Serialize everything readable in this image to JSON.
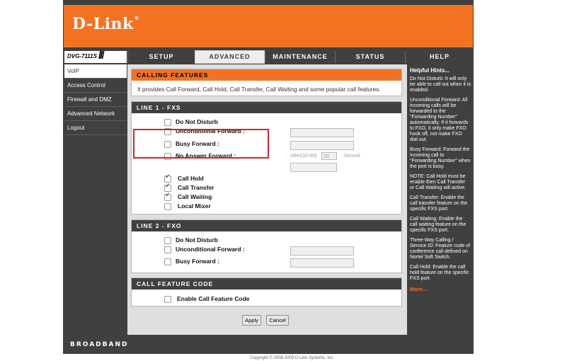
{
  "brand": {
    "logo": "D-Link",
    "footer_brand": "BROADBAND"
  },
  "model": {
    "label": "DVG-7111S"
  },
  "nav": {
    "tabs": [
      {
        "label": "SETUP"
      },
      {
        "label": "ADVANCED"
      },
      {
        "label": "MAINTENANCE"
      },
      {
        "label": "STATUS"
      },
      {
        "label": "HELP"
      }
    ],
    "active_tab": "ADVANCED"
  },
  "sidebar": {
    "items": [
      {
        "label": "VoIP"
      },
      {
        "label": "Access Control"
      },
      {
        "label": "Firewall and DMZ"
      },
      {
        "label": "Advanced Network"
      },
      {
        "label": "Logout"
      }
    ]
  },
  "calling_features": {
    "title": "CALLING FEATURES",
    "description": "It provides Call Forward, Call Hold, Call Transfer, Call Waiting and some popular call features."
  },
  "line1": {
    "title": "LINE 1 - FXS",
    "options": [
      {
        "label": "Do Not Disturb",
        "checked": false
      },
      {
        "label": "Unconditional Forward :",
        "checked": false,
        "value": ""
      },
      {
        "label": "Busy Forward :",
        "checked": false,
        "value": ""
      },
      {
        "label": "No Answer Forward :",
        "checked": false,
        "value": ""
      },
      {
        "label": "Call Hold",
        "checked": true
      },
      {
        "label": "Call Transfer",
        "checked": true
      },
      {
        "label": "Call Waiting",
        "checked": true
      },
      {
        "label": "Local Mixer",
        "checked": false
      }
    ],
    "after_label": "After(10-60)",
    "after_value": "20",
    "second_label": "Second"
  },
  "line2": {
    "title": "LINE 2 - FXO",
    "options": [
      {
        "label": "Do Not Disturb",
        "checked": false
      },
      {
        "label": "Unconditional Forward :",
        "checked": false,
        "value": ""
      },
      {
        "label": "Busy Forward :",
        "checked": false,
        "value": ""
      }
    ]
  },
  "feature_code": {
    "title": "CALL FEATURE CODE",
    "option": {
      "label": "Enable Call Feature Code",
      "checked": false
    }
  },
  "buttons": {
    "apply": "Apply",
    "cancel": "Cancel"
  },
  "help": {
    "title": "Helpful Hints...",
    "paragraphs": [
      "Do Not Disturb: It will only be able to call out when it is enabled.",
      "Unconditional Forward: All incoming calls will be forwarded to the \"Forwarding Number\" automatically. If it forwards to FXO, it only make FXO hook off, not make FXO dial out.",
      "Busy Forward: Forward the incoming call to \"Forwarding Number\" when the port is busy.",
      "NOTE: Call Hold must be enable then Call Transfer or Call Waiting will active.",
      "Call Transfer: Enable the call transfer feature on the specific FXS port.",
      "Call Waiting: Enable the call waiting feature on the specific FXS port.",
      "Three-Way Calling / Service ID: Feature code of conference call defined on Nortel Soft Switch.",
      "Call Hold: Enable the call hold feature on the specific FXS port."
    ],
    "more": "More..."
  },
  "copyright": "Copyright © 2008-2009 D-Link Systems, Inc.",
  "colors": {
    "accent": "#f37221",
    "frame": "#404040",
    "highlight": "#e02020"
  }
}
